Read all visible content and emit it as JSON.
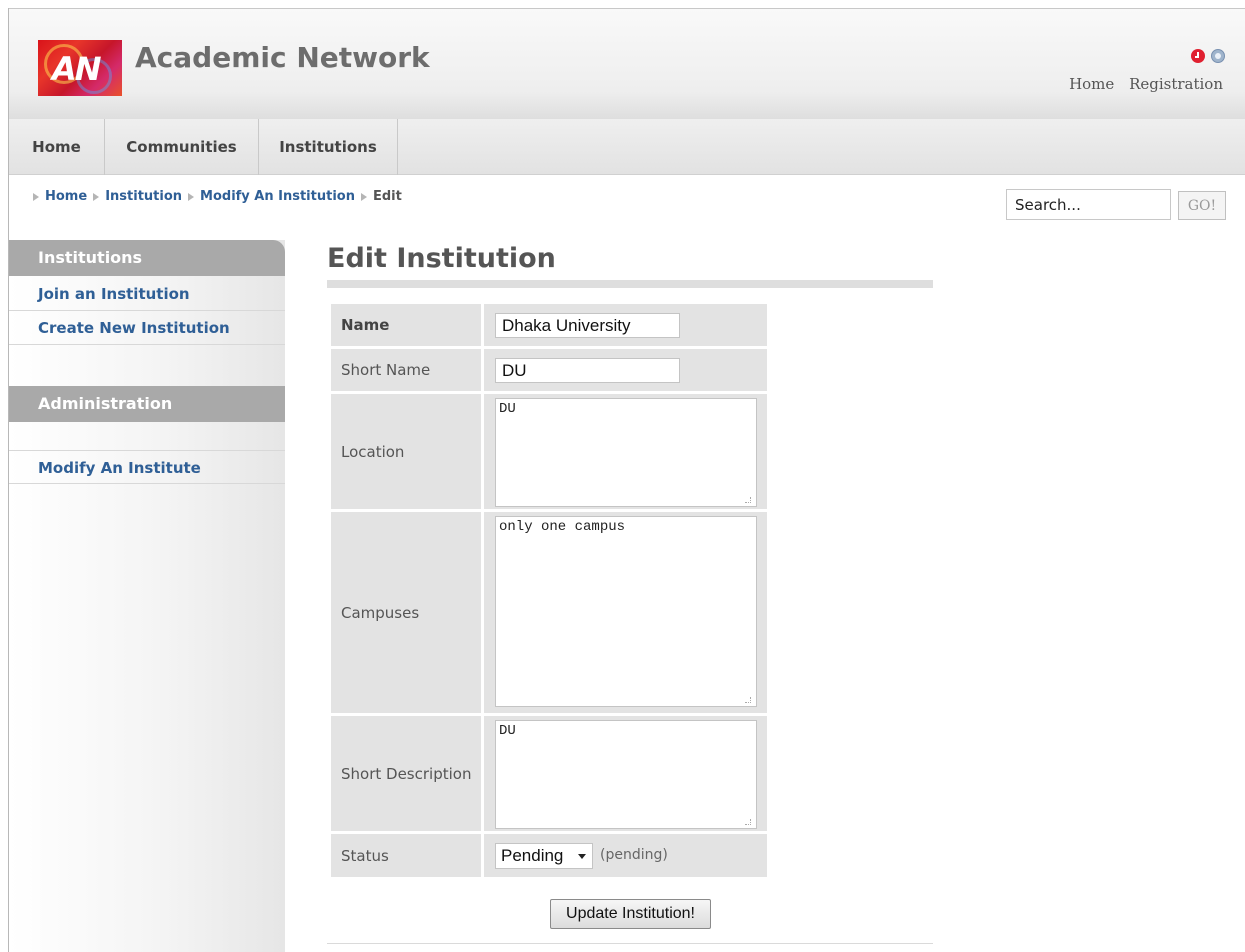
{
  "header": {
    "logo_text": "AN",
    "site_title": "Academic Network",
    "icons": [
      "clock-icon",
      "globe-icon"
    ],
    "top_links": [
      "Home",
      "Registration"
    ]
  },
  "nav": {
    "tabs": [
      "Home",
      "Communities",
      "Institutions"
    ]
  },
  "breadcrumb": {
    "items": [
      "Home",
      "Institution",
      "Modify An Institution"
    ],
    "current": "Edit"
  },
  "search": {
    "value": "Search...",
    "button_label": "GO!"
  },
  "sidebar": {
    "sections": [
      {
        "title": "Institutions",
        "items": [
          "Join an Institution",
          "Create New Institution"
        ]
      },
      {
        "title": "Administration",
        "items": [
          "Modify An Institute"
        ]
      }
    ]
  },
  "main": {
    "title": "Edit Institution",
    "form": {
      "name_label": "Name",
      "name_value": "Dhaka University",
      "short_name_label": "Short Name",
      "short_name_value": "DU",
      "location_label": "Location",
      "location_value": "DU",
      "campuses_label": "Campuses",
      "campuses_value": "only one campus",
      "short_description_label": "Short Description",
      "short_description_value": "DU",
      "status_label": "Status",
      "status_value": "Pending",
      "status_note": "(pending)",
      "submit_label": "Update Institution!"
    }
  },
  "colors": {
    "link": "#2f5f96",
    "sidebar_header": "#a9a9a9",
    "form_cell": "#e3e3e3",
    "logo_red": "#d9131a"
  }
}
